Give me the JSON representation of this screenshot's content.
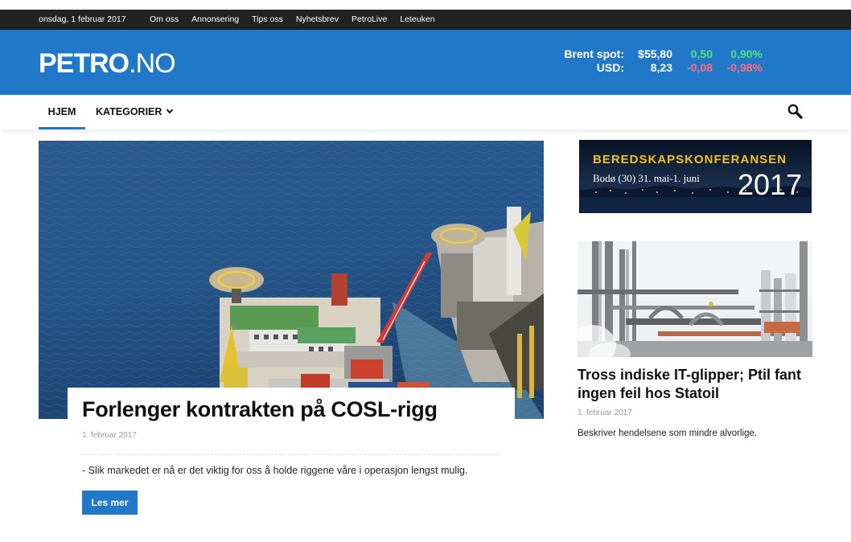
{
  "topbar": {
    "date": "onsdag, 1 februar 2017",
    "links": [
      "Om oss",
      "Annonsering",
      "Tips oss",
      "Nyhetsbrev",
      "PetroLive",
      "Leteuken"
    ]
  },
  "logo": {
    "bold": "PETRO",
    "light": ".NO"
  },
  "ticker": {
    "rows": [
      {
        "label": "Brent spot:",
        "value": "$55,80",
        "change": "0,50",
        "percent": "0,90%",
        "direction": "up"
      },
      {
        "label": "USD:",
        "value": "8,23",
        "change": "-0,08",
        "percent": "-0,98%",
        "direction": "down"
      }
    ]
  },
  "nav": {
    "home": "HJEM",
    "categories": "KATEGORIER",
    "search_icon": "search-icon"
  },
  "main_article": {
    "title": "Forlenger kontrakten på COSL-rigg",
    "date": "1. februar 2017",
    "excerpt": "- Slik markedet er nå er det viktig for oss å holde riggene våre i operasjon lengst mulig.",
    "read_more": "Les mer"
  },
  "ad": {
    "title": "BEREDSKAPSKONFERANSEN",
    "subtitle": "Bodø (30) 31. mai-1. juni",
    "year": "2017"
  },
  "side_article": {
    "title": "Tross indiske IT-glipper; Ptil fant ingen feil hos Statoil",
    "date": "1. februar 2017",
    "excerpt": "Beskriver hendelsene som mindre alvorlige."
  },
  "colors": {
    "brand_blue": "#2178c8",
    "topbar": "#222222",
    "positive": "#54e07a",
    "negative": "#ff6b81",
    "ad_gold": "#f2c21a"
  }
}
